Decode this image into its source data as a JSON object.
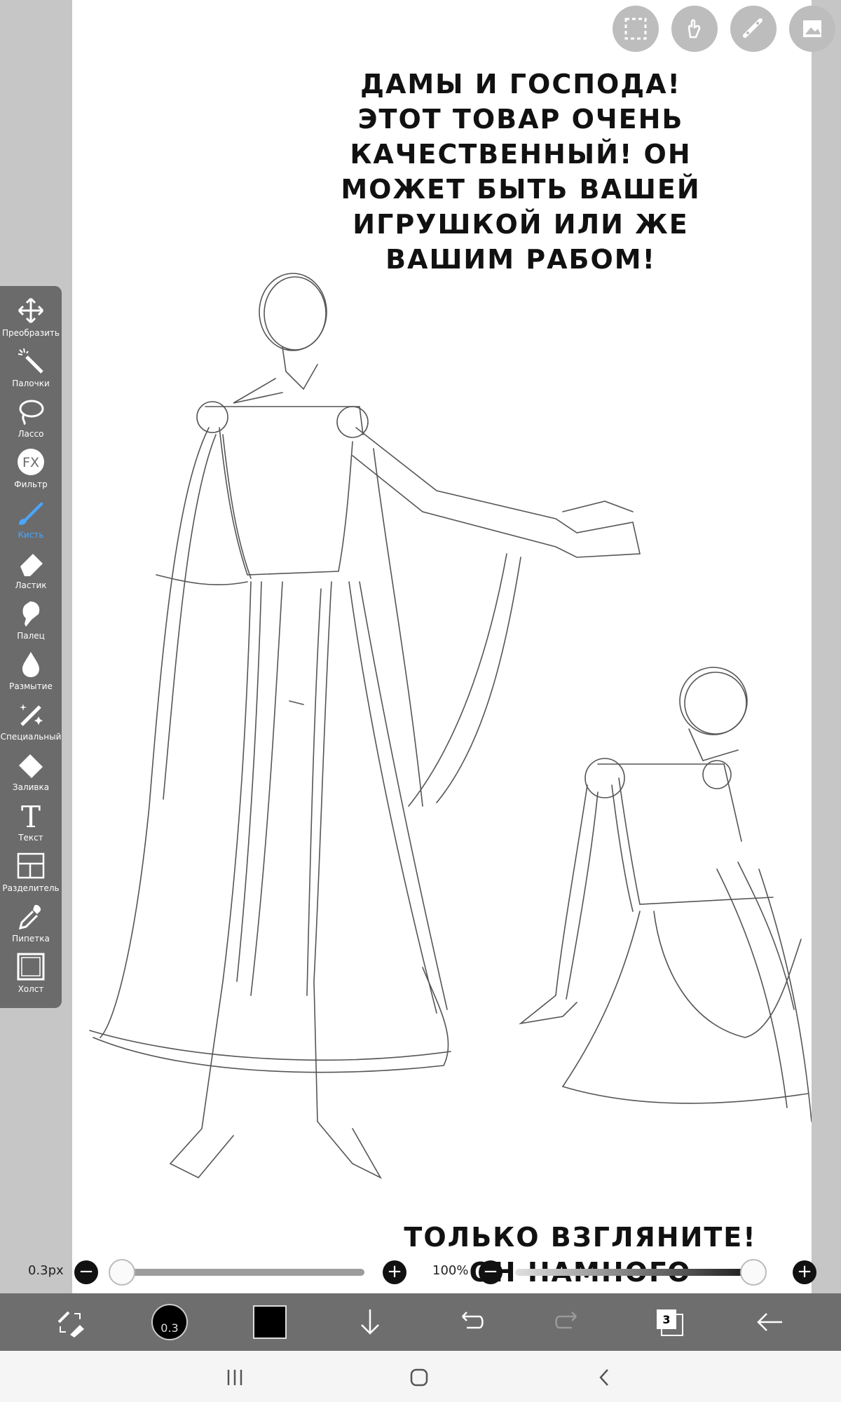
{
  "captions": {
    "top": "ДАМЫ И ГОСПОДА!\nЭТОТ ТОВАР ОЧЕНЬ\nКАЧЕСТВЕННЫЙ! ОН\nМОЖЕТ БЫТЬ ВАШЕЙ\nИГРУШКОЙ ИЛИ ЖЕ\nВАШИМ РАБОМ!",
    "bottom": "ТОЛЬКО ВЗГЛЯНИТЕ!\nОН НАМНОГО\nКРАСИВЕЕ МНОГИХ\nЖЕНЩИН!"
  },
  "top_tools": [
    {
      "icon": "selection-icon"
    },
    {
      "icon": "hand-icon"
    },
    {
      "icon": "ruler-icon"
    },
    {
      "icon": "image-icon"
    }
  ],
  "toolbar": {
    "items": [
      {
        "label": "Преобразить",
        "icon": "move-arrows-icon"
      },
      {
        "label": "Палочки",
        "icon": "magic-wand-icon"
      },
      {
        "label": "Лассо",
        "icon": "lasso-icon"
      },
      {
        "label": "Фильтр",
        "icon": "fx-icon"
      },
      {
        "label": "Кисть",
        "icon": "brush-icon",
        "active": true
      },
      {
        "label": "Ластик",
        "icon": "eraser-icon"
      },
      {
        "label": "Палец",
        "icon": "finger-icon"
      },
      {
        "label": "Размытие",
        "icon": "blur-drop-icon"
      },
      {
        "label": "Специальный",
        "icon": "special-brush-icon"
      },
      {
        "label": "Заливка",
        "icon": "fill-bucket-icon"
      },
      {
        "label": "Текст",
        "icon": "text-icon"
      },
      {
        "label": "Разделитель",
        "icon": "frame-divider-icon"
      },
      {
        "label": "Пипетка",
        "icon": "eyedropper-icon"
      },
      {
        "label": "Холст",
        "icon": "canvas-icon"
      }
    ],
    "fx_text": "FX",
    "text_glyph": "T"
  },
  "brush": {
    "size_label": "0.3px",
    "size_fraction": 0.0,
    "opacity_label": "100%",
    "opacity_fraction": 1.0,
    "minus": "−",
    "plus": "+"
  },
  "bottom_bar": {
    "brush_size": "0.3",
    "color": "#000000",
    "layer_count": "3"
  },
  "colors": {
    "toolbar": "#6b6b6b",
    "active": "#4aa6ff",
    "canvas": "#ffffff"
  }
}
